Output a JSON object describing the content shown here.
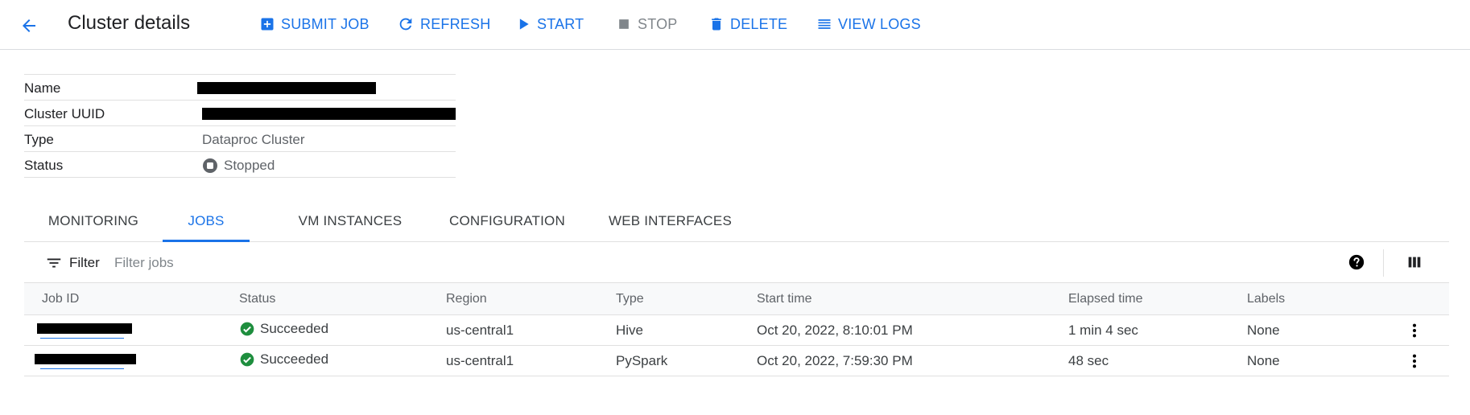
{
  "header": {
    "title": "Cluster details",
    "back_icon": "arrow-back-icon",
    "actions": {
      "submit_job": "SUBMIT JOB",
      "refresh": "REFRESH",
      "start": "START",
      "stop": "STOP",
      "delete": "DELETE",
      "view_logs": "VIEW LOGS"
    }
  },
  "details": {
    "name_label": "Name",
    "uuid_label": "Cluster UUID",
    "type_label": "Type",
    "type_value": "Dataproc Cluster",
    "status_label": "Status",
    "status_value": "Stopped"
  },
  "tabs": {
    "monitoring": "MONITORING",
    "jobs": "JOBS",
    "vm_instances": "VM INSTANCES",
    "configuration": "CONFIGURATION",
    "web_interfaces": "WEB INTERFACES",
    "active": "JOBS"
  },
  "filter": {
    "label": "Filter",
    "placeholder": "Filter jobs"
  },
  "jobs_table": {
    "columns": {
      "job_id": "Job ID",
      "status": "Status",
      "region": "Region",
      "type": "Type",
      "start_time": "Start time",
      "elapsed_time": "Elapsed time",
      "labels": "Labels"
    },
    "rows": [
      {
        "status": "Succeeded",
        "region": "us-central1",
        "type": "Hive",
        "start_time": "Oct 20, 2022, 8:10:01 PM",
        "elapsed_time": "1 min 4 sec",
        "labels": "None"
      },
      {
        "status": "Succeeded",
        "region": "us-central1",
        "type": "PySpark",
        "start_time": "Oct 20, 2022, 7:59:30 PM",
        "elapsed_time": "48 sec",
        "labels": "None"
      }
    ]
  },
  "colors": {
    "accent": "#1a73e8",
    "success": "#1e8e3e",
    "stopped": "#5f6368",
    "redaction": "#000000"
  }
}
